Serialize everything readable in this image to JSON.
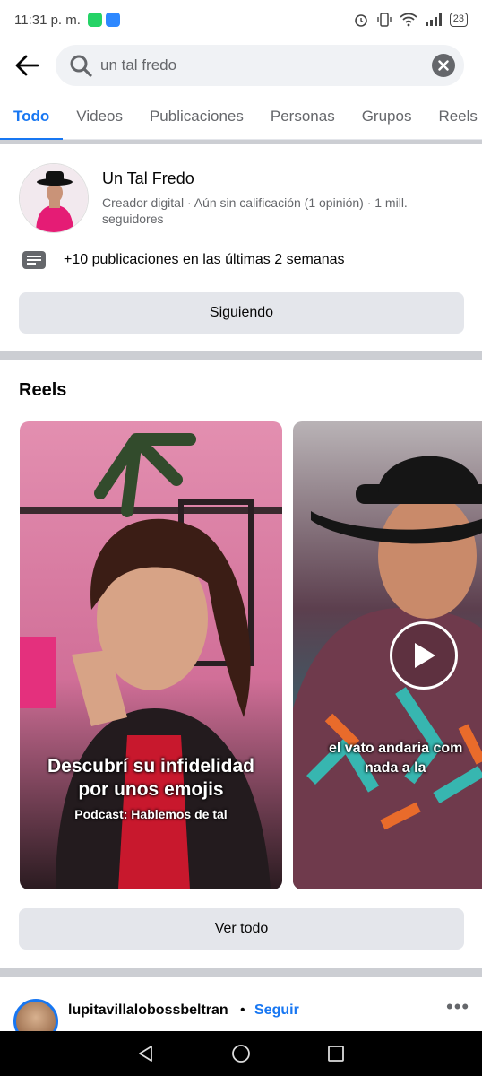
{
  "status_bar": {
    "time": "11:31 p. m.",
    "battery": "23",
    "icons": [
      "whatsapp-icon",
      "voicemail-icon",
      "alarm-icon",
      "vibrate-icon",
      "wifi-icon",
      "signal-icon"
    ]
  },
  "search": {
    "query": "un tal fredo",
    "icons": [
      "back-arrow-icon",
      "search-icon",
      "clear-icon"
    ]
  },
  "tabs": [
    {
      "label": "Todo",
      "active": true
    },
    {
      "label": "Videos"
    },
    {
      "label": "Publicaciones"
    },
    {
      "label": "Personas"
    },
    {
      "label": "Grupos"
    },
    {
      "label": "Reels"
    }
  ],
  "profile": {
    "name": "Un Tal Fredo",
    "subtitle": "Creador digital · Aún sin calificación (1 opinión) · 1 mill. seguidores",
    "recent_posts": "+10 publicaciones en las últimas 2 semanas",
    "follow_button": "Siguiendo"
  },
  "reels": {
    "title": "Reels",
    "items": [
      {
        "caption_line1": "Descubrí su infidelidad",
        "caption_line2": "por unos emojis",
        "subcaption": "Podcast: Hablemos de tal"
      },
      {
        "caption_line1": "el vato andaria com",
        "caption_line2": "nada a la"
      }
    ],
    "see_all": "Ver todo"
  },
  "post": {
    "username": "lupitavillalobossbeltran",
    "separator": "•",
    "follow": "Seguir",
    "more": "•••"
  },
  "colors": {
    "accent": "#1877f2",
    "button_bg": "#e4e6eb",
    "secondary_text": "#65676b"
  }
}
